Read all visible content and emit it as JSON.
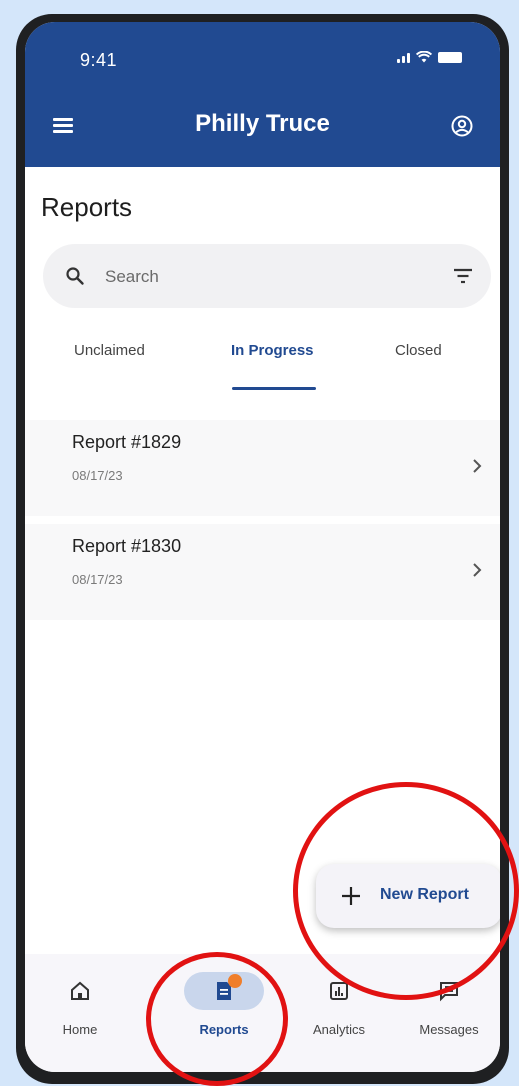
{
  "status_bar": {
    "time": "9:41"
  },
  "app_bar": {
    "title": "Philly Truce",
    "menu_icon": "menu-icon",
    "account_icon": "account-icon"
  },
  "page": {
    "title": "Reports"
  },
  "search": {
    "placeholder": "Search",
    "value": ""
  },
  "tabs": [
    {
      "label": "Unclaimed",
      "active": false
    },
    {
      "label": "In Progress",
      "active": true
    },
    {
      "label": "Closed",
      "active": false
    }
  ],
  "reports": [
    {
      "title": "Report #1829",
      "date": "08/17/23"
    },
    {
      "title": "Report #1830",
      "date": "08/17/23"
    }
  ],
  "fab": {
    "label": "New Report",
    "icon": "plus-icon"
  },
  "bottom_nav": [
    {
      "label": "Home",
      "icon": "home-icon",
      "active": false
    },
    {
      "label": "Reports",
      "icon": "reports-icon",
      "active": true
    },
    {
      "label": "Analytics",
      "icon": "analytics-icon",
      "active": false
    },
    {
      "label": "Messages",
      "icon": "messages-icon",
      "active": false
    }
  ],
  "colors": {
    "primary": "#214a91",
    "background": "#d4e6fa",
    "badge": "#f07e2a",
    "annotation": "#e11212"
  }
}
